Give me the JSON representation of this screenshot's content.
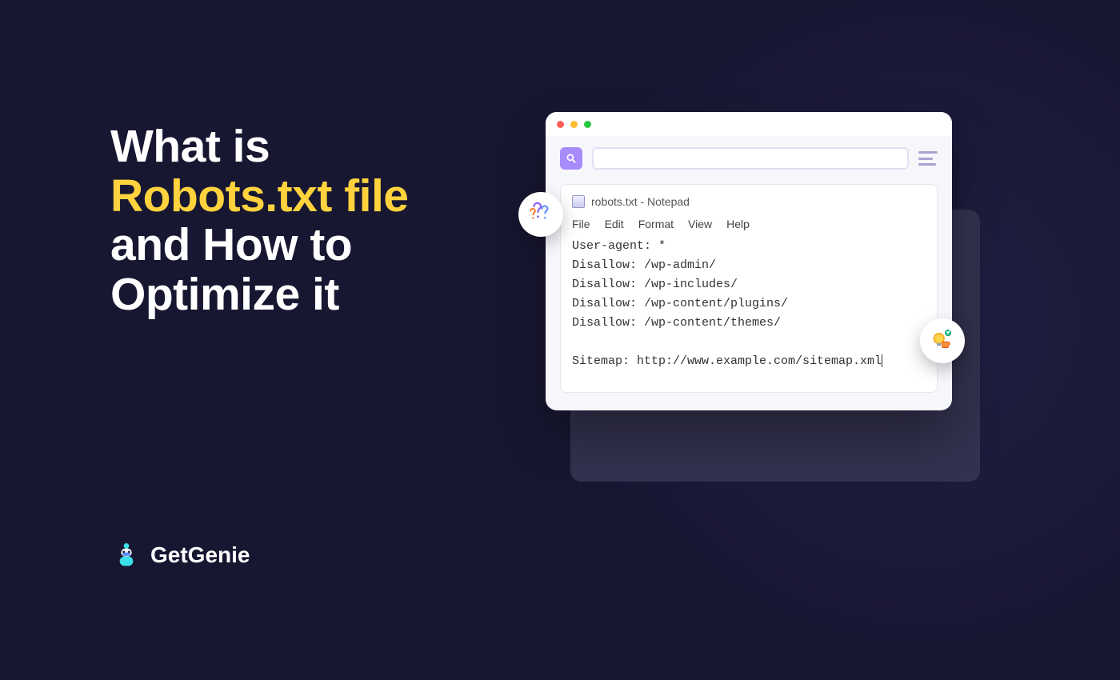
{
  "headline": {
    "line1": "What is",
    "accent": "Robots.txt file",
    "line3": "and How to",
    "line4": "Optimize it"
  },
  "brand": {
    "name": "GetGenie"
  },
  "notepad": {
    "title": "robots.txt - Notepad",
    "menu": {
      "file": "File",
      "edit": "Edit",
      "format": "Format",
      "view": "View",
      "help": "Help"
    },
    "lines": {
      "l1": "User-agent: *",
      "l2": "Disallow: /wp-admin/",
      "l3": "Disallow: /wp-includes/",
      "l4": "Disallow: /wp-content/plugins/",
      "l5": "Disallow: /wp-content/themes/",
      "blank": " ",
      "sitemap": "Sitemap: http://www.example.com/sitemap.xml"
    }
  }
}
